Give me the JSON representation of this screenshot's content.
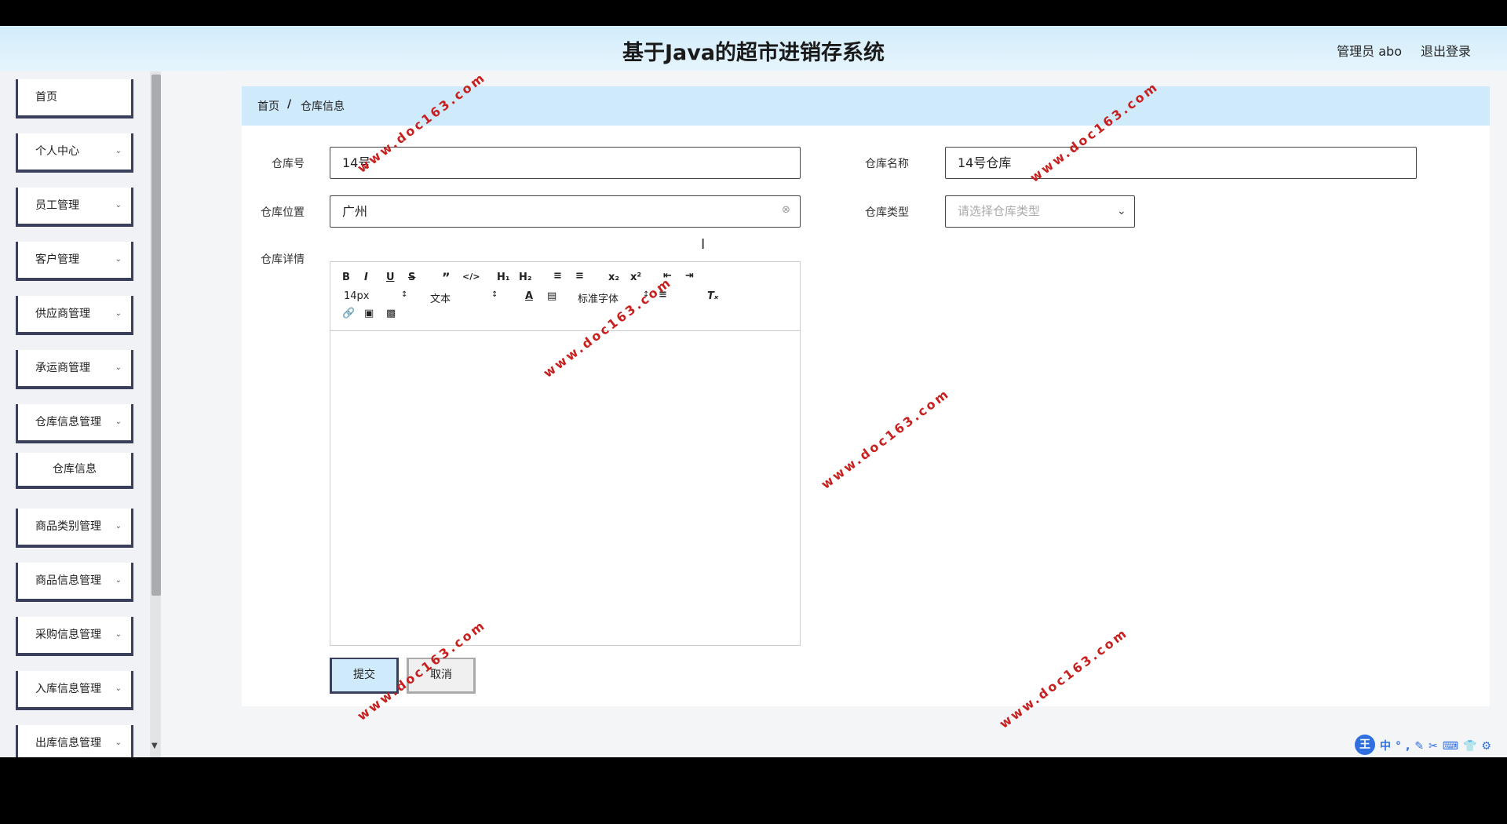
{
  "header": {
    "title": "基于Java的超市进销存系统",
    "user": "管理员 abo",
    "logout": "退出登录"
  },
  "sidebar": {
    "items": [
      {
        "label": "首页"
      },
      {
        "label": "个人中心"
      },
      {
        "label": "员工管理"
      },
      {
        "label": "客户管理"
      },
      {
        "label": "供应商管理"
      },
      {
        "label": "承运商管理"
      },
      {
        "label": "仓库信息管理"
      },
      {
        "label": "商品类别管理"
      },
      {
        "label": "商品信息管理"
      },
      {
        "label": "采购信息管理"
      },
      {
        "label": "入库信息管理"
      },
      {
        "label": "出库信息管理"
      }
    ],
    "sub_item": "仓库信息"
  },
  "breadcrumb": {
    "home": "首页",
    "separator": "/",
    "current": "仓库信息"
  },
  "form": {
    "warehouse_no": {
      "label": "仓库号",
      "value": "14号"
    },
    "warehouse_name": {
      "label": "仓库名称",
      "value": "14号仓库"
    },
    "location": {
      "label": "仓库位置",
      "value": "广州"
    },
    "type": {
      "label": "仓库类型",
      "placeholder": "请选择仓库类型"
    },
    "details": {
      "label": "仓库详情"
    },
    "submit": "提交",
    "cancel": "取消"
  },
  "editor_toolbar": {
    "font_size": "14px",
    "heading": "文本",
    "font_family": "标准字体"
  },
  "watermark": "www.doc163.com",
  "ime": {
    "logo": "王",
    "items": "中°,✎✂⌨👕⚙"
  }
}
